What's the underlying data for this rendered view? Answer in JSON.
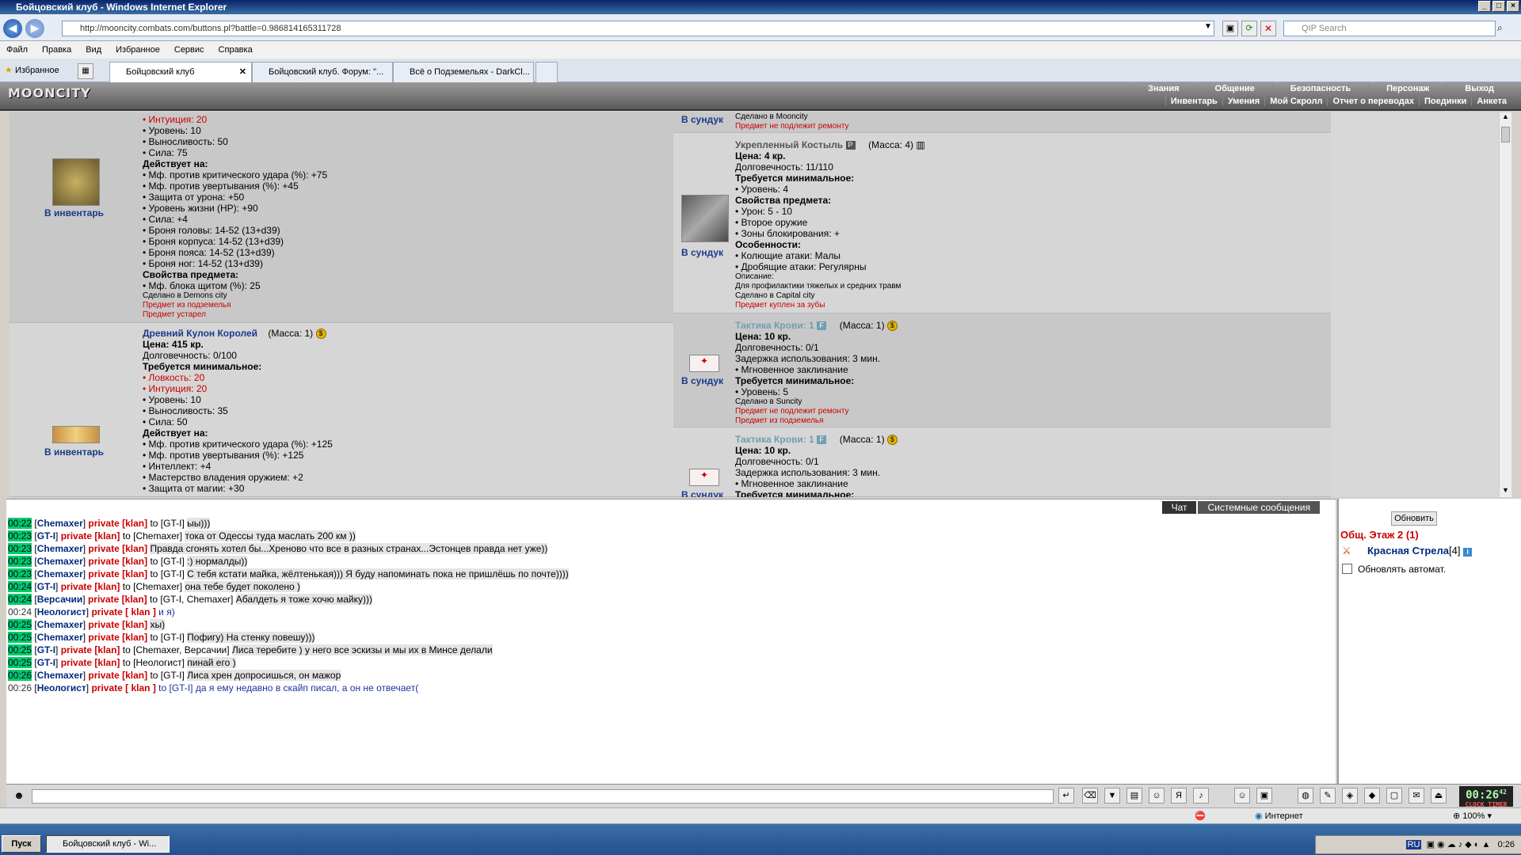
{
  "window": {
    "title": "Бойцовский клуб - Windows Internet Explorer"
  },
  "browser": {
    "url": "http://mooncity.combats.com/buttons.pl?battle=0.986814165311728",
    "search_placeholder": "QIP Search",
    "menu": [
      "Файл",
      "Правка",
      "Вид",
      "Избранное",
      "Сервис",
      "Справка"
    ],
    "favorites": "Избранное",
    "tabs": [
      "Бойцовский клуб",
      "Бойцовский клуб. Форум: \"...",
      "Всё о Подземельях - DarkCl..."
    ]
  },
  "game": {
    "logo": "MOONCITY",
    "nav_top": [
      "Знания",
      "Общение",
      "Безопасность",
      "Персонаж",
      "Выход"
    ],
    "nav_bottom": [
      "Инвентарь",
      "Умения",
      "Мой Скролл",
      "Отчет о переводах",
      "Поединки",
      "Анкета"
    ]
  },
  "left_items": [
    {
      "action": "В инвентарь",
      "lines": [
        {
          "t": "• Интуиция: 20",
          "c": "red"
        },
        {
          "t": "• Уровень: 10"
        },
        {
          "t": "• Выносливость: 50"
        },
        {
          "t": "• Сила: 75"
        },
        {
          "t": "Действует на:",
          "c": "b"
        },
        {
          "t": "• Мф. против критического удара (%): +75"
        },
        {
          "t": "• Мф. против увертывания (%): +45"
        },
        {
          "t": "• Защита от урона: +50"
        },
        {
          "t": "• Уровень жизни (HP): +90"
        },
        {
          "t": "• Сила: +4"
        },
        {
          "t": "• Броня головы: 14-52 (13+d39)"
        },
        {
          "t": "• Броня корпуса: 14-52 (13+d39)"
        },
        {
          "t": "• Броня пояса: 14-52 (13+d39)"
        },
        {
          "t": "• Броня ног: 14-52 (13+d39)"
        },
        {
          "t": "Свойства предмета:",
          "c": "b"
        },
        {
          "t": "• Мф. блока щитом (%): 25"
        },
        {
          "t": "Сделано в Demons city",
          "c": "sm"
        },
        {
          "t": "Предмет из подземелья",
          "c": "smred"
        },
        {
          "t": "Предмет устарел",
          "c": "smred"
        }
      ]
    },
    {
      "action": "В инвентарь",
      "name": "Древний Кулон Королей",
      "mass": "(Масса: 1)",
      "lines": [
        {
          "t": "Цена: 415 кр.",
          "c": "b"
        },
        {
          "t": "Долговечность: 0/100"
        },
        {
          "t": "Требуется минимальное:",
          "c": "b"
        },
        {
          "t": "• Ловкость: 20",
          "c": "red"
        },
        {
          "t": "• Интуиция: 20",
          "c": "red"
        },
        {
          "t": "• Уровень: 10"
        },
        {
          "t": "• Выносливость: 35"
        },
        {
          "t": "• Сила: 50"
        },
        {
          "t": "Действует на:",
          "c": "b"
        },
        {
          "t": "• Мф. против критического удара (%): +125"
        },
        {
          "t": "• Мф. против увертывания (%): +125"
        },
        {
          "t": "• Интеллект: +4"
        },
        {
          "t": "• Мастерство владения оружием: +2"
        },
        {
          "t": "• Защита от магии: +30"
        }
      ]
    }
  ],
  "right_items": [
    {
      "action": "В сундук",
      "lines": [
        {
          "t": "Сделано в Mooncity",
          "c": "sm"
        },
        {
          "t": "Предмет не подлежит ремонту",
          "c": "smred"
        }
      ]
    },
    {
      "action": "В сундук",
      "name": "Укрепленный Костыль",
      "badge": "P",
      "mass": "(Масса: 4)",
      "lines": [
        {
          "t": "Цена: 4 кр.",
          "c": "b"
        },
        {
          "t": "Долговечность: 11/110"
        },
        {
          "t": "Требуется минимальное:",
          "c": "b"
        },
        {
          "t": "• Уровень: 4"
        },
        {
          "t": "Свойства предмета:",
          "c": "b"
        },
        {
          "t": "• Урон: 5 - 10"
        },
        {
          "t": "• Второе оружие"
        },
        {
          "t": "• Зоны блокирования: +"
        },
        {
          "t": "Особенности:",
          "c": "b"
        },
        {
          "t": "• Колющие атаки: Малы"
        },
        {
          "t": "• Дробящие атаки: Регулярны"
        },
        {
          "t": "Описание:",
          "c": "sm"
        },
        {
          "t": "Для профилактики тяжелых и средних травм",
          "c": "sm"
        },
        {
          "t": "Сделано в Capital city",
          "c": "sm"
        },
        {
          "t": "Предмет куплен за зубы",
          "c": "smred"
        }
      ]
    },
    {
      "action": "В сундук",
      "name": "Тактика Крови: 1",
      "badge": "F",
      "mass": "(Масса: 1)",
      "lines": [
        {
          "t": "Цена: 10 кр.",
          "c": "b"
        },
        {
          "t": "Долговечность: 0/1"
        },
        {
          "t": "Задержка использования: 3 мин."
        },
        {
          "t": "• Мгновенное заклинание"
        },
        {
          "t": "Требуется минимальное:",
          "c": "b"
        },
        {
          "t": "• Уровень: 5"
        },
        {
          "t": "Сделано в Suncity",
          "c": "sm"
        },
        {
          "t": "Предмет не подлежит ремонту",
          "c": "smred"
        },
        {
          "t": "Предмет из подземелья",
          "c": "smred"
        }
      ]
    },
    {
      "action": "В сундук",
      "name": "Тактика Крови: 1",
      "badge": "F",
      "mass": "(Масса: 1)",
      "lines": [
        {
          "t": "Цена: 10 кр.",
          "c": "b"
        },
        {
          "t": "Долговечность: 0/1"
        },
        {
          "t": "Задержка использования: 3 мин."
        },
        {
          "t": "• Мгновенное заклинание"
        },
        {
          "t": "Требуется минимальное:",
          "c": "b"
        }
      ]
    }
  ],
  "chat": {
    "tabs": [
      "Чат",
      "Системные сообщения"
    ],
    "lines": [
      {
        "time": "00:22",
        "from": "Chemaxer",
        "tag": "private [klan]",
        "to": "to [GT-I]",
        "msg": "ыы)))"
      },
      {
        "time": "00:23",
        "from": "GT-I",
        "tag": "private [klan]",
        "to": "to [Chemaxer]",
        "msg": "тока от Одессы туда маслать 200 км ))"
      },
      {
        "time": "00:23",
        "from": "Chemaxer",
        "tag": "private [klan]",
        "to": "",
        "msg": "Правда сгонять хотел бы...Хреново что все в разных странах...Эстонцев правда нет уже))"
      },
      {
        "time": "00:23",
        "from": "Chemaxer",
        "tag": "private [klan]",
        "to": "to [GT-I]",
        "msg": ":) нормалды))"
      },
      {
        "time": "00:23",
        "from": "Chemaxer",
        "tag": "private [klan]",
        "to": "to [GT-I]",
        "msg": "С тебя кстати майка, жёлтенькая))) Я буду напоминать пока не пришлёшь по почте))))"
      },
      {
        "time": "00:24",
        "from": "GT-I",
        "tag": "private [klan]",
        "to": "to [Chemaxer]",
        "msg": "она тебе будет поколено )"
      },
      {
        "time": "00:24",
        "from": "Версачии",
        "tag": "private [klan]",
        "to": "to [GT-I, Chemaxer]",
        "msg": "Абалдеть я тоже хочю майку)))"
      },
      {
        "time": "00:24",
        "from": "Неологист",
        "tag": "private [ klan ]",
        "to": "",
        "msg": "и я)",
        "plain": true
      },
      {
        "time": "00:25",
        "from": "Chemaxer",
        "tag": "private [klan]",
        "to": "",
        "msg": "хы)"
      },
      {
        "time": "00:25",
        "from": "Chemaxer",
        "tag": "private [klan]",
        "to": "to [GT-I]",
        "msg": "Пофигу) На стенку повешу)))"
      },
      {
        "time": "00:25",
        "from": "GT-I",
        "tag": "private [klan]",
        "to": "to [Chemaxer, Версачии]",
        "msg": "Лиса теребите ) у него все эскизы и мы их в Минсе делали"
      },
      {
        "time": "00:25",
        "from": "GT-I",
        "tag": "private [klan]",
        "to": "to [Неологист]",
        "msg": "пинай его )"
      },
      {
        "time": "00:26",
        "from": "Chemaxer",
        "tag": "private [klan]",
        "to": "to [GT-I]",
        "msg": "Лиса хрен допросишься, он мажор"
      },
      {
        "time": "00:26",
        "from": "Неологист",
        "tag": "private [ klan ]",
        "to": "to [GT-I]",
        "msg": "да я ему недавно в скайп писал, а он не отвечает(",
        "plain": true
      }
    ]
  },
  "room": {
    "refresh": "Обновить",
    "title": "Общ. Этаж 2 (1)",
    "user": "Красная Стрела",
    "level": "[4]",
    "auto": "Обновлять автомат."
  },
  "clock": {
    "time": "00:26",
    "sec": "42",
    "label": "CLOCK TIMER"
  },
  "status": {
    "zone": "Интернет",
    "zoom": "100%"
  },
  "taskbar": {
    "start": "Пуск",
    "item": "Бойцовский клуб - Wi...",
    "lang": "RU",
    "time": "0:26"
  }
}
